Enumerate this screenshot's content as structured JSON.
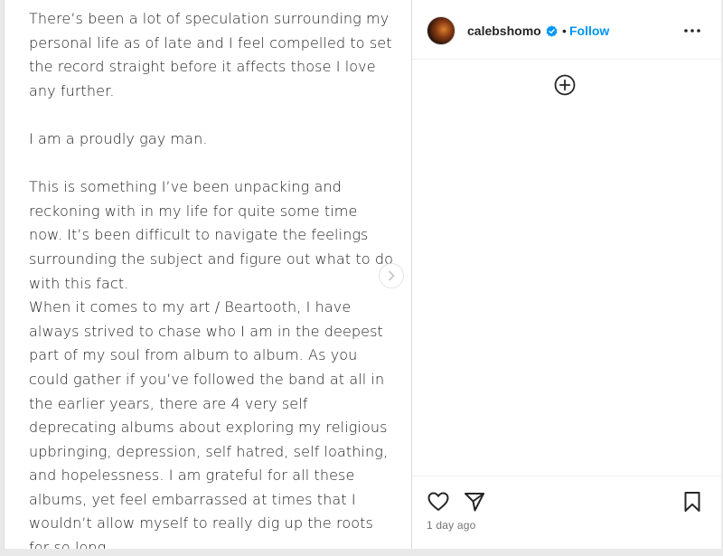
{
  "post": {
    "paragraphs": [
      "There’s been a lot of speculation surrounding my personal life as of late and I feel compelled to set the record straight before it affects those I love any further.",
      "",
      "I am a proudly gay man.",
      "",
      "This is something I’ve been unpacking and reckoning with in my life for quite some time now. It’s been difficult to navigate the feelings surrounding the subject and figure out what to do with this fact.",
      "When it comes to my art / Beartooth, I have always strived to chase who I am in the deepest part of my soul from album to album. As you could gather if you’ve followed the band at all in the earlier years, there are 4 very self deprecating albums about exploring my religious upbringing, depression, self hatred, self loathing, and hopelessness. I am grateful for all these albums, yet feel embarrassed at times that I wouldn’t allow myself to really dig up the roots for so long."
    ]
  },
  "header": {
    "username": "calebshomo",
    "separator": "•",
    "follow_label": "Follow"
  },
  "footer": {
    "timestamp": "1 day ago"
  },
  "colors": {
    "link": "#0095f6",
    "verified": "#0095f6",
    "text": "#262626"
  },
  "icons": {
    "more": "more-horizontal-icon",
    "add": "plus-circle-icon",
    "like": "heart-icon",
    "share": "paper-plane-icon",
    "save": "bookmark-icon",
    "next": "chevron-right-icon",
    "verified": "verified-badge-icon"
  }
}
